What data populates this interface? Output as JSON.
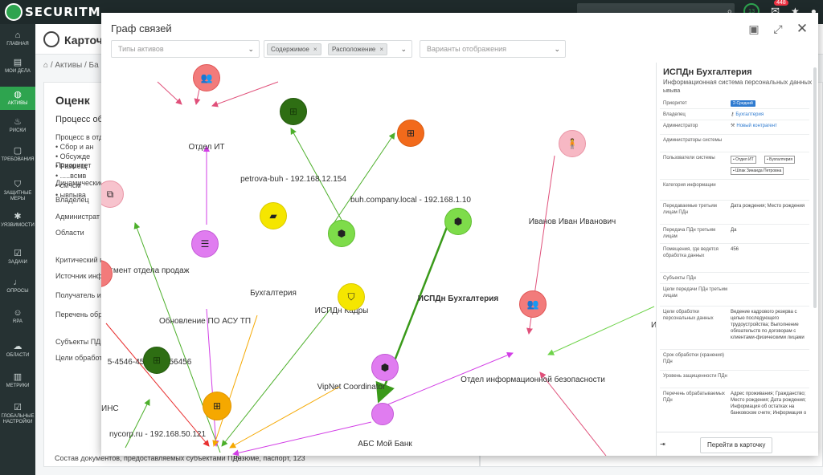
{
  "topbar": {
    "logo": "SECURITM",
    "license_badge": "13",
    "notif_count": "448"
  },
  "sidebar": [
    {
      "label": "ГЛАВНАЯ",
      "icon": "home-icon",
      "glyph": "⌂"
    },
    {
      "label": "МОИ ДЕЛА",
      "icon": "briefcase-icon",
      "glyph": "▤"
    },
    {
      "label": "АКТИВЫ",
      "icon": "globe-icon",
      "glyph": "◍"
    },
    {
      "label": "РИСКИ",
      "icon": "flame-icon",
      "glyph": "♨"
    },
    {
      "label": "ТРЕБОВАНИЯ",
      "icon": "document-icon",
      "glyph": "▢"
    },
    {
      "label": "ЗАЩИТНЫЕ МЕРЫ",
      "icon": "shield-icon",
      "glyph": "⛉"
    },
    {
      "label": "УЯЗВИМОСТИ",
      "icon": "bug-icon",
      "glyph": "✱"
    },
    {
      "label": "ЗАДАЧИ",
      "icon": "checkbox-icon",
      "glyph": "☑"
    },
    {
      "label": "ОПРОСЫ",
      "icon": "microphone-icon",
      "glyph": "♩"
    },
    {
      "label": "RPA",
      "icon": "robot-icon",
      "glyph": "☺"
    },
    {
      "label": "ОБЛАСТИ",
      "icon": "cloud-icon",
      "glyph": "☁"
    },
    {
      "label": "МЕТРИКИ",
      "icon": "chart-icon",
      "glyph": "▥"
    },
    {
      "label": "ГЛОБАЛЬНЫЕ НАСТРОЙКИ",
      "icon": "settings-check-icon",
      "glyph": "☑"
    }
  ],
  "bg": {
    "title": "Карточк",
    "crumbs": "⌂  /  Активы  /  Ба",
    "card_title": "Оценк",
    "section": "Процесс обр",
    "list": [
      "Процесс в отде",
      "• Сбор и ан",
      "• Обсужде",
      "• Размещ",
      "• .....всмв",
      "• смчсм",
      "• ывпыва"
    ],
    "rows": [
      "Приоритет",
      "Динамические",
      "Владелец",
      "Администрат",
      "Области",
      "Критический пр",
      "Источник инфо",
      "Получатель инфо",
      "Перечень обраб",
      "Субъекты ПДн",
      "Цели обработк"
    ],
    "bottom_label": "Состав документов, предоставляемых субъектами ПДн",
    "bottom_value": "Резюме, паспорт, 123"
  },
  "modal": {
    "title": "Граф связей",
    "filter_types_placeholder": "Типы активов",
    "chips": [
      "Содержимое",
      "Расположение"
    ],
    "display_placeholder": "Варианты отображения"
  },
  "graph": {
    "nodes": [
      {
        "name": "node-otdel-it",
        "label": "Отдел ИТ",
        "color": "#f27b7b",
        "border": "#e05555",
        "icon": "user-group-icon",
        "glyph": "👥"
      },
      {
        "name": "node-petrova-buh",
        "label": "petrova-buh - 192.168.12.154",
        "color": "#2e6e13",
        "border": "#245a0e",
        "icon": "windows-icon",
        "glyph": "⊞"
      },
      {
        "name": "node-buh-company",
        "label": "buh.company.local - 192.168.1.10",
        "color": "#f26a1b",
        "border": "#d95a10",
        "icon": "windows-icon",
        "glyph": "⊞"
      },
      {
        "name": "node-ivanov",
        "label": "Иванов Иван Иванович",
        "color": "#f7b8c4",
        "border": "#e995a6",
        "icon": "person-icon",
        "glyph": "🧍"
      },
      {
        "name": "node-segment-prodazh",
        "label": "сегмент отдела продаж",
        "color": "#f7c3cd",
        "border": "#e995a6",
        "icon": "network-icon",
        "glyph": "⧉"
      },
      {
        "name": "node-buhgalteria",
        "label": "Бухгалтерия",
        "color": "#f5e600",
        "border": "#d9c900",
        "icon": "folder-icon",
        "glyph": "▰"
      },
      {
        "name": "node-ispdn-kadry",
        "label": "ИСПДн Кадры",
        "color": "#7edc4a",
        "border": "#5fbd30",
        "icon": "cube-icon",
        "glyph": "⬢"
      },
      {
        "name": "node-ispdn-buh",
        "label": "ИСПДн Бухгалтерия",
        "color": "#7edc4a",
        "border": "#5fbd30",
        "icon": "cube-icon",
        "glyph": "⬢",
        "bold": true
      },
      {
        "name": "node-obnovlenie",
        "label": "Обновление ПО АСУ ТП",
        "color": "#e07cf0",
        "border": "#c35ad6",
        "icon": "stairs-icon",
        "glyph": "☰"
      },
      {
        "name": "node-vipnet",
        "label": "VipNet Coordinator",
        "color": "#f5e600",
        "border": "#d9c900",
        "icon": "shield-icon",
        "glyph": "⛉"
      },
      {
        "name": "node-otdel-ib",
        "label": "Отдел информационной безопасности",
        "color": "#f27b7b",
        "border": "#e05555",
        "icon": "user-group-icon",
        "glyph": "👥"
      },
      {
        "name": "node-abs",
        "label": "АБС Мой Банк",
        "color": "#e07cf0",
        "border": "#c35ad6",
        "icon": "cube-icon",
        "glyph": "⬢"
      },
      {
        "name": "node-left-partial",
        "label": "5-4546-456546-456456",
        "color": "#f27b7b",
        "border": "#e05555",
        "icon": "circle-icon",
        "glyph": ""
      },
      {
        "name": "node-mycorp",
        "label": "nycorp.ru - 192.168.50.121",
        "color": "#2e6e13",
        "border": "#245a0e",
        "icon": "windows-icon",
        "glyph": "⊞"
      },
      {
        "name": "node-center",
        "label": "",
        "color": "#f5a800",
        "border": "#e09400",
        "icon": "windows-icon",
        "glyph": "⊞"
      },
      {
        "name": "node-bottom-partial",
        "label": "",
        "color": "#e07cf0",
        "border": "#c35ad6",
        "icon": "circle-icon",
        "glyph": ""
      }
    ],
    "partial_labels": {
      "ishs": "ИНС",
      "i_right": "И"
    }
  },
  "panel": {
    "title": "ИСПДн Бухгалтерия",
    "subtitle": "Информационная система персональных данных",
    "subtitle2": "ывыва",
    "rows": [
      {
        "label": "Приоритет",
        "value": "2-Средний",
        "type": "priority"
      },
      {
        "label": "Владелец",
        "value": "Бухгалтерия",
        "type": "link",
        "icon": "key-icon"
      },
      {
        "label": "Администратор",
        "value": "Новый контрагент",
        "type": "link",
        "icon": "wrench-icon"
      },
      {
        "label": "Администраторы системы",
        "value": "",
        "type": "text"
      },
      {
        "label": "Пользователи системы",
        "value": "",
        "type": "users"
      },
      {
        "label": "Категория информации",
        "value": "",
        "type": "text"
      },
      {
        "label": "Передаваемые третьим лицам ПДн",
        "value": "Дата рождения; Место рождения",
        "type": "text"
      },
      {
        "label": "Передача ПДн третьим лицам",
        "value": "Да",
        "type": "text"
      },
      {
        "label": "Помещения, где ведется обработка данных",
        "value": "456",
        "type": "text"
      },
      {
        "label": "Субъекты ПДн",
        "value": "",
        "type": "text"
      },
      {
        "label": "Цели передачи ПДн третьим лицам",
        "value": "",
        "type": "text"
      },
      {
        "label": "Цели обработки персональных данных",
        "value": "Ведение кадрового резерва с целью последующего трудоустройства; Выполнение обязательств по договорам с клиентами-физическими лицами",
        "type": "text"
      },
      {
        "label": "Срок обработки (хранения) ПДн",
        "value": "",
        "type": "text"
      },
      {
        "label": "Уровень защищенности ПДн",
        "value": "",
        "type": "text"
      },
      {
        "label": "Перечень обрабатываемых ПДн",
        "value": "Адрес проживания; Гражданство; Место рождения; Дата рождения; Информация об остатках на банковском счете; Информация о",
        "type": "text"
      }
    ],
    "users": [
      "Отдел ИТ",
      "Бухгалтерия",
      "Шпак Зинаида Петровна"
    ],
    "goto_button": "Перейти в карточку",
    "collapse_icon_glyph": "⇥"
  }
}
